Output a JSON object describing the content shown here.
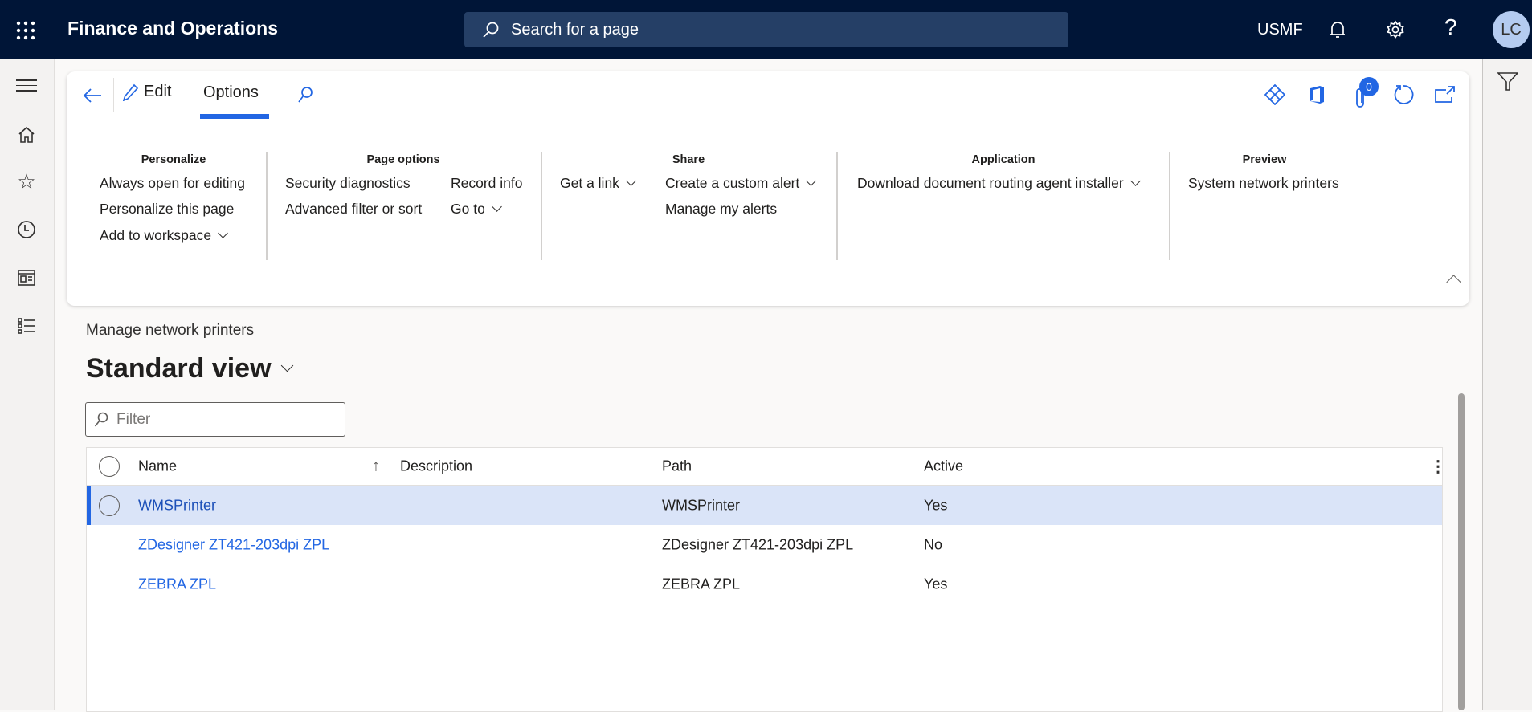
{
  "header": {
    "app_title": "Finance and Operations",
    "search_placeholder": "Search for a page",
    "company": "USMF",
    "avatar_initials": "LC"
  },
  "action_pane": {
    "edit_label": "Edit",
    "options_tab": "Options",
    "attachments_count": "0",
    "groups": [
      {
        "title": "Personalize",
        "items": [
          "Always open for editing",
          "Personalize this page",
          "Add to workspace"
        ]
      },
      {
        "title": "Page options",
        "items": [
          "Security diagnostics",
          "Advanced filter or sort",
          "Record info",
          "Go to"
        ]
      },
      {
        "title": "Share",
        "items": [
          "Get a link",
          "Create a custom alert",
          "Manage my alerts"
        ]
      },
      {
        "title": "Application",
        "items": [
          "Download document routing agent installer"
        ]
      },
      {
        "title": "Preview",
        "items": [
          "System network printers"
        ]
      }
    ]
  },
  "page": {
    "caption": "Manage network printers",
    "view_name": "Standard view",
    "filter_placeholder": "Filter"
  },
  "grid": {
    "columns": [
      "Name",
      "Description",
      "Path",
      "Active"
    ],
    "rows": [
      {
        "name": "WMSPrinter",
        "description": "",
        "path": "WMSPrinter",
        "active": "Yes"
      },
      {
        "name": "ZDesigner ZT421-203dpi ZPL",
        "description": "",
        "path": "ZDesigner ZT421-203dpi ZPL",
        "active": "No"
      },
      {
        "name": "ZEBRA ZPL",
        "description": "",
        "path": "ZEBRA ZPL",
        "active": "Yes"
      }
    ]
  },
  "colors": {
    "header_bg": "#001537",
    "accent": "#2266e3",
    "selected_row": "#dae4f8"
  }
}
